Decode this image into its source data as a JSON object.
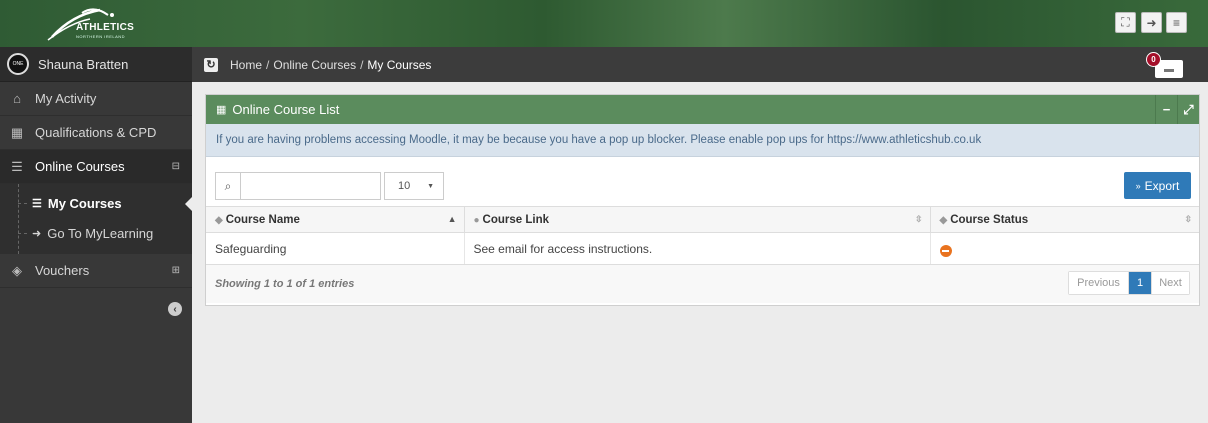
{
  "brand": {
    "logo_title": "ATHLETICS",
    "logo_subtitle": "NORTHERN IRELAND"
  },
  "topbar": {
    "buttons": [
      "fullscreen-icon",
      "logout-icon",
      "menu-icon"
    ]
  },
  "user": {
    "name": "Shauna Bratten",
    "avatar_text": "ONE"
  },
  "sidebar": {
    "items": [
      {
        "label": "My Activity",
        "icon": "home-icon"
      },
      {
        "label": "Qualifications & CPD",
        "icon": "calendar-icon"
      },
      {
        "label": "Online Courses",
        "icon": "list-icon",
        "expanded": true
      },
      {
        "label": "Vouchers",
        "icon": "tag-icon"
      }
    ],
    "sub_items": [
      {
        "label": "My Courses",
        "current": true
      },
      {
        "label": "Go To MyLearning"
      }
    ]
  },
  "breadcrumb": {
    "home": "Home",
    "section": "Online Courses",
    "current": "My Courses"
  },
  "cart": {
    "count": "0"
  },
  "panel": {
    "title": "Online Course List",
    "alert": "If you are having problems accessing Moodle, it may be because you have a pop up blocker. Please enable pop ups for https://www.athleticshub.co.uk",
    "search_value": "",
    "page_length": "10",
    "export_label": "Export",
    "columns": [
      "Course Name",
      "Course Link",
      "Course Status"
    ],
    "rows": [
      {
        "name": "Safeguarding",
        "link": "See email for access instructions.",
        "status": "blocked"
      }
    ],
    "info": "Showing 1 to 1 of 1 entries",
    "pager": {
      "previous": "Previous",
      "current": "1",
      "next": "Next"
    }
  },
  "colors": {
    "header_green": "#5b8c5d",
    "export_blue": "#2f7ab8",
    "status_orange": "#e9731f",
    "cart_badge": "#a50f2a"
  }
}
